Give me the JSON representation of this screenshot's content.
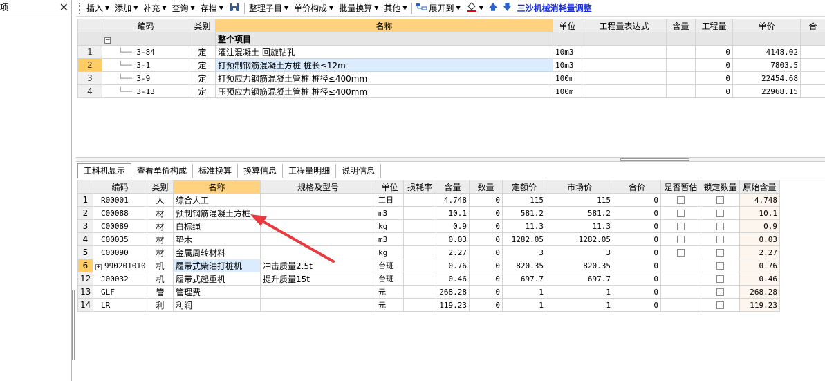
{
  "left_panel": {
    "title": "项",
    "close_label": "✕"
  },
  "toolbar": {
    "insert": "插入",
    "add": "添加",
    "supplement": "补充",
    "query": "查询",
    "archive": "存档",
    "organize": "整理子目",
    "price_composition": "单价构成",
    "batch_convert": "批量换算",
    "other": "其他",
    "expand_to": "展开到",
    "special": "三沙机械消耗量调整"
  },
  "upper_table": {
    "headers": [
      "编码",
      "类别",
      "名称",
      "单位",
      "工程量表达式",
      "含量",
      "工程量",
      "单价",
      "合"
    ],
    "group_row": {
      "name": "整个项目"
    },
    "rows": [
      {
        "no": "1",
        "code": "3-84",
        "type": "定",
        "name": "灌注混凝土 回旋钻孔",
        "unit": "10m3",
        "expr": "",
        "content": "",
        "qty": "0",
        "price": "4148.02"
      },
      {
        "no": "2",
        "code": "3-1",
        "type": "定",
        "name": "打预制钢筋混凝土方桩 桩长≤12m",
        "unit": "10m3",
        "expr": "",
        "content": "",
        "qty": "0",
        "price": "7803.5"
      },
      {
        "no": "3",
        "code": "3-9",
        "type": "定",
        "name": "打预应力钢筋混凝土管桩 桩径≤400mm",
        "unit": "100m",
        "expr": "",
        "content": "",
        "qty": "0",
        "price": "22454.68"
      },
      {
        "no": "4",
        "code": "3-13",
        "type": "定",
        "name": "压预应力钢筋混凝土管桩 桩径≤400mm",
        "unit": "100m",
        "expr": "",
        "content": "",
        "qty": "0",
        "price": "22968.15"
      }
    ]
  },
  "tabs": [
    "工料机显示",
    "查看单价构成",
    "标准换算",
    "换算信息",
    "工程量明细",
    "说明信息"
  ],
  "lower_table": {
    "headers": [
      "编码",
      "类别",
      "名称",
      "规格及型号",
      "单位",
      "损耗率",
      "含量",
      "数量",
      "定额价",
      "市场价",
      "合价",
      "是否暂估",
      "锁定数量",
      "原始含量"
    ],
    "rows": [
      {
        "no": "1",
        "code": "R00001",
        "type": "人",
        "name": "综合人工",
        "spec": "",
        "unit": "工日",
        "loss": "",
        "content": "4.748",
        "qty": "0",
        "quota": "115",
        "market": "115",
        "total": "0",
        "est": true,
        "lock": true,
        "orig": "4.748"
      },
      {
        "no": "2",
        "code": "C00088",
        "type": "材",
        "name": "预制钢筋混凝土方桩",
        "spec": "",
        "unit": "m3",
        "loss": "",
        "content": "10.1",
        "qty": "0",
        "quota": "581.2",
        "market": "581.2",
        "total": "0",
        "est": true,
        "lock": true,
        "orig": "10.1"
      },
      {
        "no": "3",
        "code": "C00089",
        "type": "材",
        "name": "白棕绳",
        "spec": "",
        "unit": "kg",
        "loss": "",
        "content": "0.9",
        "qty": "0",
        "quota": "11.3",
        "market": "11.3",
        "total": "0",
        "est": true,
        "lock": true,
        "orig": "0.9"
      },
      {
        "no": "4",
        "code": "C00035",
        "type": "材",
        "name": "垫木",
        "spec": "",
        "unit": "m3",
        "loss": "",
        "content": "0.03",
        "qty": "0",
        "quota": "1282.05",
        "market": "1282.05",
        "total": "0",
        "est": true,
        "lock": true,
        "orig": "0.03"
      },
      {
        "no": "5",
        "code": "C00090",
        "type": "材",
        "name": "金属周转材料",
        "spec": "",
        "unit": "kg",
        "loss": "",
        "content": "2.27",
        "qty": "0",
        "quota": "3",
        "market": "3",
        "total": "0",
        "est": true,
        "lock": true,
        "orig": "2.27"
      },
      {
        "no": "6",
        "code": "990201010",
        "type": "机",
        "name": "履带式柴油打桩机",
        "spec": "冲击质量2.5t",
        "unit": "台班",
        "loss": "",
        "content": "0.76",
        "qty": "0",
        "quota": "820.35",
        "market": "820.35",
        "total": "0",
        "est": false,
        "lock": true,
        "orig": "0.76"
      },
      {
        "no": "12",
        "code": "J00032",
        "type": "机",
        "name": "履带式起重机",
        "spec": "提升质量15t",
        "unit": "台班",
        "loss": "",
        "content": "0.46",
        "qty": "0",
        "quota": "697.7",
        "market": "697.7",
        "total": "0",
        "est": false,
        "lock": true,
        "orig": "0.46"
      },
      {
        "no": "13",
        "code": "GLF",
        "type": "管",
        "name": "管理费",
        "spec": "",
        "unit": "元",
        "loss": "",
        "content": "268.28",
        "qty": "0",
        "quota": "1",
        "market": "1",
        "total": "0",
        "est": false,
        "lock": true,
        "orig": "268.28"
      },
      {
        "no": "14",
        "code": "LR",
        "type": "利",
        "name": "利润",
        "spec": "",
        "unit": "元",
        "loss": "",
        "content": "119.23",
        "qty": "0",
        "quota": "1",
        "market": "1",
        "total": "0",
        "est": false,
        "lock": true,
        "orig": "119.23"
      }
    ]
  },
  "colors": {
    "selected_row": "#ffcc66",
    "header_highlight": "#ffd27f",
    "annotation_arrow": "#e8393f",
    "special_tool": "#1a2fd9"
  }
}
